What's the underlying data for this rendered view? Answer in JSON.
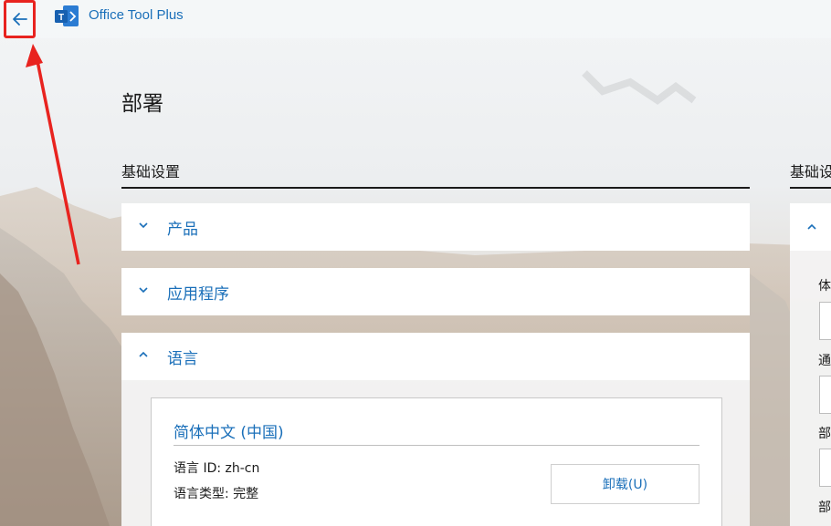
{
  "app": {
    "title": "Office Tool Plus"
  },
  "page": {
    "title": "部署"
  },
  "basic_settings": {
    "header": "基础设置",
    "sections": [
      {
        "label": "产品",
        "expanded": false
      },
      {
        "label": "应用程序",
        "expanded": false
      },
      {
        "label": "语言",
        "expanded": true
      }
    ],
    "language_card": {
      "name": "简体中文 (中国)",
      "id_line": "语言 ID: zh-cn",
      "type_line": "语言类型: 完整",
      "uninstall_button": "卸载(U)"
    }
  },
  "right_column": {
    "header": "基础设",
    "labels": [
      "体",
      "通",
      "部",
      "部"
    ]
  },
  "colors": {
    "accent": "#1a6fb9",
    "highlight": "#e8231f"
  }
}
